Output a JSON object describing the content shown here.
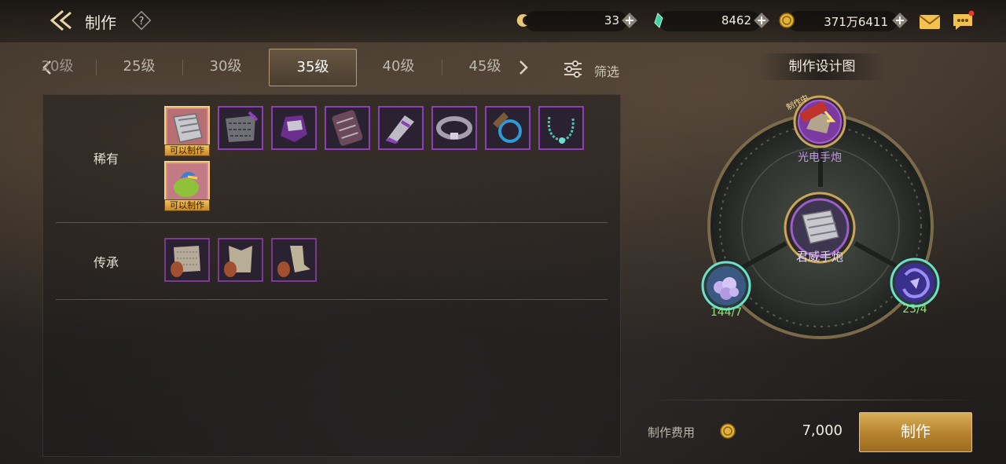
{
  "header": {
    "title": "制作",
    "currencies": [
      {
        "icon": "crescent-token-icon",
        "value": "33"
      },
      {
        "icon": "green-crystal-icon",
        "value": "8462"
      },
      {
        "icon": "gold-coin-icon",
        "value": "371万6411"
      }
    ]
  },
  "level_tabs": [
    {
      "label": "20级"
    },
    {
      "label": "25级"
    },
    {
      "label": "30级"
    },
    {
      "label": "35级",
      "active": true
    },
    {
      "label": "40级"
    },
    {
      "label": "45级"
    }
  ],
  "filter": {
    "label": "筛选",
    "icon": "filter-sliders-icon"
  },
  "categories": [
    {
      "label": "稀有",
      "items": [
        {
          "icon": "rare-gauntlet-icon",
          "badge": "可以制作",
          "selected": true
        },
        {
          "icon": "scale-armor-icon"
        },
        {
          "icon": "purple-helm-icon"
        },
        {
          "icon": "studded-vambrace-icon"
        },
        {
          "icon": "purple-greave-icon"
        },
        {
          "icon": "silver-belt-icon"
        },
        {
          "icon": "bronze-ring-icon"
        },
        {
          "icon": "jade-necklace-icon"
        },
        {
          "icon": "green-pouch-icon",
          "badge": "可以制作"
        }
      ]
    },
    {
      "label": "传承",
      "items": [
        {
          "icon": "heritage-chainmail-icon"
        },
        {
          "icon": "heritage-vest-icon"
        },
        {
          "icon": "heritage-boots-icon"
        }
      ]
    }
  ],
  "blueprint": {
    "title": "制作设计图",
    "top_node": {
      "label": "光电手炮",
      "tag": "制作中"
    },
    "center_node": {
      "label": "君威手炮"
    },
    "left_node": {
      "count": "144/7"
    },
    "right_node": {
      "count": "23/4"
    }
  },
  "crafting": {
    "cost_label": "制作费用",
    "cost_value": "7,000",
    "button_label": "制作"
  },
  "colors": {
    "accent_gold": "#c89535",
    "rare_purple": "#8d3fb5",
    "count_green": "#8fe07a"
  }
}
